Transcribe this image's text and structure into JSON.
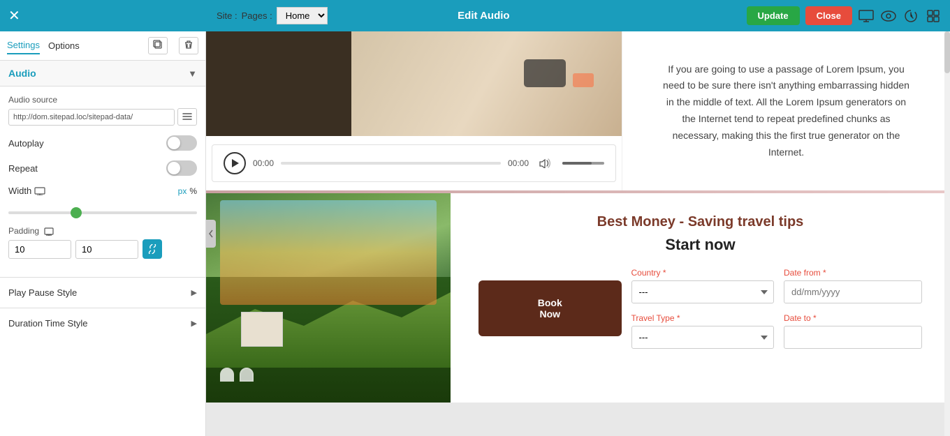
{
  "topbar": {
    "title": "Edit Audio",
    "close_icon": "✕",
    "site_label": "Site :",
    "pages_label": "Pages :",
    "pages_value": "Home",
    "update_label": "Update",
    "close_label": "Close"
  },
  "left_panel": {
    "tab_settings": "Settings",
    "tab_options": "Options",
    "section_audio": "Audio",
    "audio_source_label": "Audio source",
    "audio_source_value": "http://dom.sitepad.loc/sitepad-data/",
    "autoplay_label": "Autoplay",
    "repeat_label": "Repeat",
    "width_label": "Width",
    "width_icon": "🖥",
    "unit_px": "px",
    "unit_percent": "%",
    "padding_label": "Padding",
    "padding_left": "10",
    "padding_right": "10",
    "play_pause_style": "Play Pause Style",
    "duration_time_style": "Duration Time Style"
  },
  "audio_player": {
    "time_start": "00:00",
    "time_end": "00:00"
  },
  "canvas": {
    "lorem_text": "If you are going to use a passage of Lorem Ipsum, you need to be sure there isn't anything embarrassing hidden in the middle of text. All the Lorem Ipsum generators on the Internet tend to repeat predefined chunks as necessary, making this the first true generator on the Internet.",
    "travel_title": "Best Money - Saving travel tips",
    "travel_subtitle": "Start now",
    "country_label": "Country *",
    "country_placeholder": "---",
    "date_from_label": "Date from *",
    "date_from_placeholder": "dd/mm/yyyy",
    "travel_type_label": "Travel Type *",
    "date_to_label": "Date to *",
    "book_label": "Book\nNow"
  }
}
